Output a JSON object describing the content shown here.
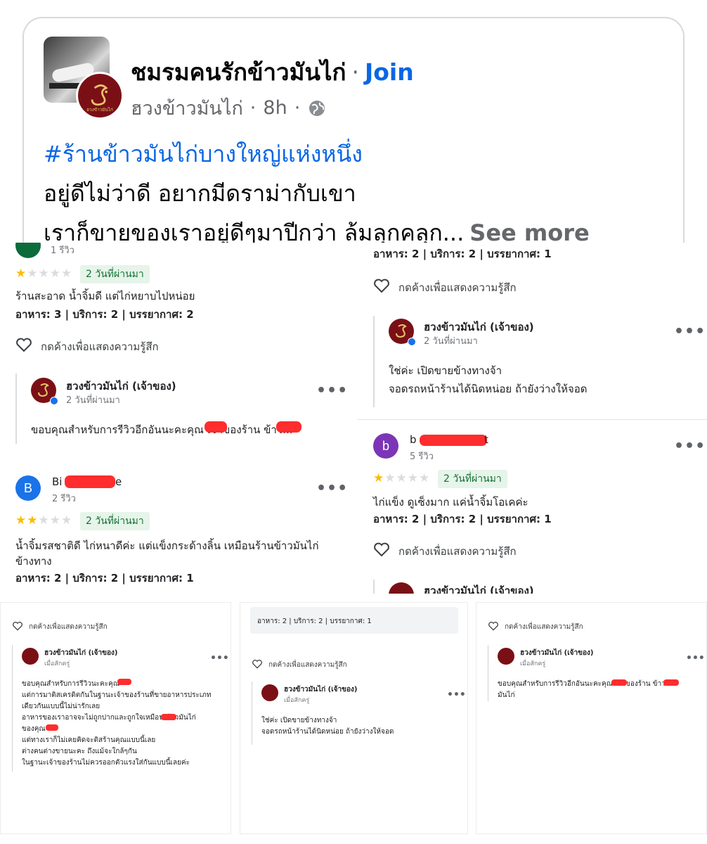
{
  "post": {
    "group_name": "ชมรมคนรักข้าวมันไก่",
    "separator": "·",
    "join_label": "Join",
    "author": "ฮวงข้าวมันไก่",
    "time": "8h",
    "hashtag": "#ร้านข้าวมันไก่บางใหญ่แห่งหนึ่ง",
    "line1": "อยู่ดีไม่ว่าดี อยากมีดราม่ากับเขา",
    "line2": "เราก็ขายของเราอยู่ดีๆมาปีกว่า ล้มลุกคลุก...",
    "see_more": "See more"
  },
  "reviews": {
    "react_label": "กดค้างเพื่อแสดงความรู้สึก",
    "owner_name": "ฮวงข้าวมันไก่ (เจ้าของ)",
    "ago": "2 วันที่ผ่านมา",
    "just_now": "เมื่อสักครู่",
    "more": "•••",
    "logo_text": "ฮวงข้าวมันไก่",
    "p1": {
      "review_count": "1 รีวิว",
      "rating": 1,
      "text": "ร้านสะอาด น้ำจิ้มดี แต่ไก่หยาบไปหน่อย",
      "scores": "อาหาร: 3 | บริการ: 2 | บรรยากาศ: 2",
      "reply": "ขอบคุณสำหรับการรีวิวอีกอันนะคะคุณ        เจ้าของร้าน         ข้าว..."
    },
    "p2": {
      "user_initial": "B",
      "user_name_start": "Bi",
      "user_name_end": "e",
      "review_count": "2 รีวิว",
      "rating": 2,
      "text1": "น้ำจิ้มรสชาติดี ไก่หนาดีค่ะ แต่แข็งกระด้างลิ้น เหมือนร้านข้าวมันไก่",
      "text2": "ข้างทาง",
      "scores": "อาหาร: 2 | บริการ: 2 | บรรยากาศ: 1"
    },
    "p3": {
      "scores": "อาหาร: 2 | บริการ: 2 | บรรยากาศ: 1",
      "reply1": "ใช่ค่ะ เปิดขายข้างทางจ้า",
      "reply2": "จอดรถหน้าร้านได้นิดหน่อย ถ้ายังว่างให้จอด"
    },
    "p4": {
      "user_initial": "b",
      "user_name_start": "b",
      "user_name_end": "t",
      "review_count": "5 รีวิว",
      "rating": 1,
      "text": "ไก่แข็ง ดูเซ็งมาก แค่น้ำจิ้มโอเคค่ะ",
      "scores": "อาหาร: 2 | บริการ: 2 | บรรยากาศ: 1"
    },
    "p5": {
      "lines": [
        "ขอบคุณสำหรับการรีวิวนะคะคุณ",
        "แต่การมาติสเครดิตกันในฐานะเจ้าของร้านที่ขายอาหารประเภท",
        "เดียวกันแบบนี้ไม่น่ารักเลย",
        "อาหารของเราอาจจะไม่ถูกปากและถูกใจเหมือน      ข้าวมันไก่",
        "ของคุณ",
        "แต่ทางเราก็ไม่เคยคิดจะติสร้านคุณแบบนี้เลย",
        "ต่างคนต่างขายนะคะ ถึงแม้จะใกล้ๆกัน",
        "ในฐานะเจ้าของร้านไม่ควรออกตัวแรงใส่กันแบบนี้เลยค่ะ"
      ]
    },
    "p6": {
      "scores": "อาหาร: 2 | บริการ: 2 | บรรยากาศ: 1",
      "reply1": "ใช่ค่ะ เปิดขายข้างทางจ้า",
      "reply2": "จอดรถหน้าร้านได้นิดหน่อย ถ้ายังว่างให้จอด"
    },
    "p7": {
      "reply1": "ขอบคุณสำหรับการรีวิวอีกอันนะคะคุณ      เจ้าของร้าน      ข้าว",
      "reply2": "มันไก่"
    }
  },
  "icons": [
    "globe-icon",
    "heart-icon",
    "more-options-icon",
    "verified-badge-icon",
    "star-icon"
  ],
  "colors": {
    "link": "#0a66e4",
    "star": "#fbbc04",
    "tag_bg": "#e6f4ea",
    "tag_text": "#137333",
    "redaction": "#ff2d2d",
    "brand": "#7a1016"
  }
}
